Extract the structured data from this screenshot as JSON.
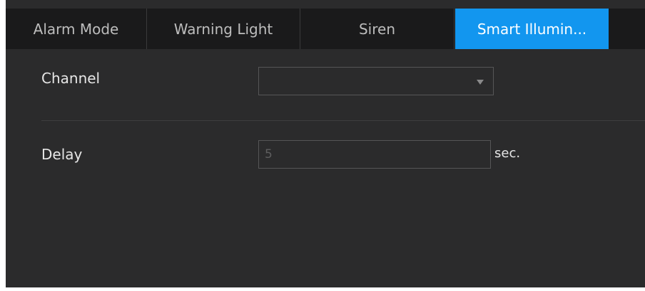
{
  "tabs": [
    {
      "label": "Alarm Mode"
    },
    {
      "label": "Warning Light"
    },
    {
      "label": "Siren"
    },
    {
      "label": "Smart Illumin..."
    }
  ],
  "form": {
    "channel_label": "Channel",
    "channel_value": "",
    "delay_label": "Delay",
    "delay_value": "5",
    "delay_unit": "sec."
  },
  "colors": {
    "active_tab": "#1296ef",
    "panel_bg": "#2b2b2c",
    "tabbar_bg": "#1a1a1b"
  },
  "icons": {
    "select_caret": "triangle-down-icon"
  }
}
